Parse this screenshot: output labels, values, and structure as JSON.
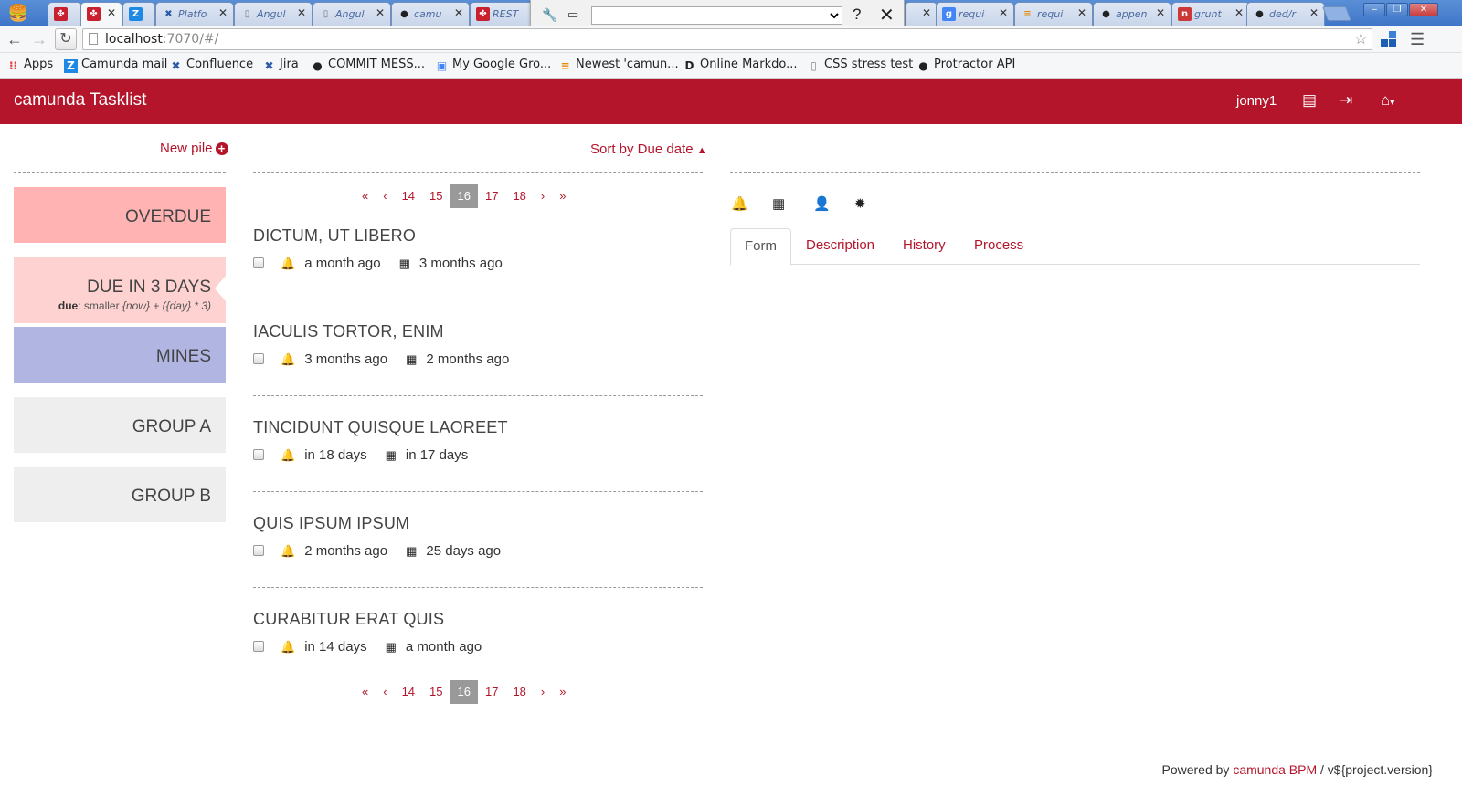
{
  "browser": {
    "tabs": [
      {
        "label": "",
        "icon": "camunda-icon"
      },
      {
        "label": "",
        "icon": "camunda-icon",
        "active": true
      },
      {
        "label": "",
        "icon": "z-icon"
      },
      {
        "label": "Platfo",
        "icon": "confluence-icon"
      },
      {
        "label": "Angul",
        "icon": "page-icon"
      },
      {
        "label": "Angul",
        "icon": "page-icon"
      },
      {
        "label": "camu",
        "icon": "github-icon"
      },
      {
        "label": "REST",
        "icon": "camunda-icon"
      },
      {
        "label": "",
        "icon": "page-icon"
      },
      {
        "label": "requi",
        "icon": "google-icon"
      },
      {
        "label": "requi",
        "icon": "stackoverflow-icon"
      },
      {
        "label": "appen",
        "icon": "github-icon"
      },
      {
        "label": "grunt",
        "icon": "npm-icon"
      },
      {
        "label": "ded/r",
        "icon": "github-icon"
      }
    ],
    "url_host": "localhost",
    "url_rest": ":7070/#/",
    "bookmarks": [
      {
        "label": "Apps",
        "icon": "apps-icon"
      },
      {
        "label": "Camunda mail",
        "icon": "z-icon"
      },
      {
        "label": "Confluence",
        "icon": "confluence-icon"
      },
      {
        "label": "Jira",
        "icon": "jira-icon"
      },
      {
        "label": "COMMIT MESS...",
        "icon": "github-icon"
      },
      {
        "label": "My Google Gro...",
        "icon": "google-groups-icon"
      },
      {
        "label": "Newest 'camun...",
        "icon": "stackoverflow-icon"
      },
      {
        "label": "Online Markdo...",
        "icon": "markdown-icon"
      },
      {
        "label": "CSS stress test",
        "icon": "page-icon"
      },
      {
        "label": "Protractor API",
        "icon": "github-icon"
      }
    ],
    "devtools_help": "?",
    "devtools_close": "✕"
  },
  "app": {
    "brand": "camunda Tasklist",
    "user": "jonny1",
    "accent": "#b5152b"
  },
  "piles": {
    "new_pile": "New pile",
    "items": [
      {
        "name": "OVERDUE",
        "color": "#ffb3b3"
      },
      {
        "name": "DUE IN 3 DAYS",
        "color": "#ffd2d2",
        "filter_key": "due",
        "filter_text": ": smaller ",
        "filter_expr": "{now} + ({day} * 3)"
      },
      {
        "name": "MINES",
        "color": "#b1b5e2"
      },
      {
        "name": "GROUP A",
        "color": "#eeeeee"
      },
      {
        "name": "GROUP B",
        "color": "#eeeeee"
      }
    ]
  },
  "tasks": {
    "sort_label": "Sort by Due date",
    "pager": [
      "«",
      "‹",
      "14",
      "15",
      "16",
      "17",
      "18",
      "›",
      "»"
    ],
    "current_page": "16",
    "items": [
      {
        "title": "DICTUM, UT LIBERO",
        "followup": "a month ago",
        "due": "3 months ago"
      },
      {
        "title": "IACULIS TORTOR, ENIM",
        "followup": "3 months ago",
        "due": "2 months ago"
      },
      {
        "title": "TINCIDUNT QUISQUE LAOREET",
        "followup": "in 18 days",
        "due": "in 17 days"
      },
      {
        "title": "QUIS IPSUM IPSUM",
        "followup": "2 months ago",
        "due": "25 days ago"
      },
      {
        "title": "CURABITUR ERAT QUIS",
        "followup": "in 14 days",
        "due": "a month ago"
      }
    ]
  },
  "details": {
    "tabs": [
      "Form",
      "Description",
      "History",
      "Process"
    ],
    "active_tab": "Form"
  },
  "footer": {
    "prefix": "Powered by ",
    "link": "camunda BPM",
    "suffix": " / v${project.version}"
  }
}
